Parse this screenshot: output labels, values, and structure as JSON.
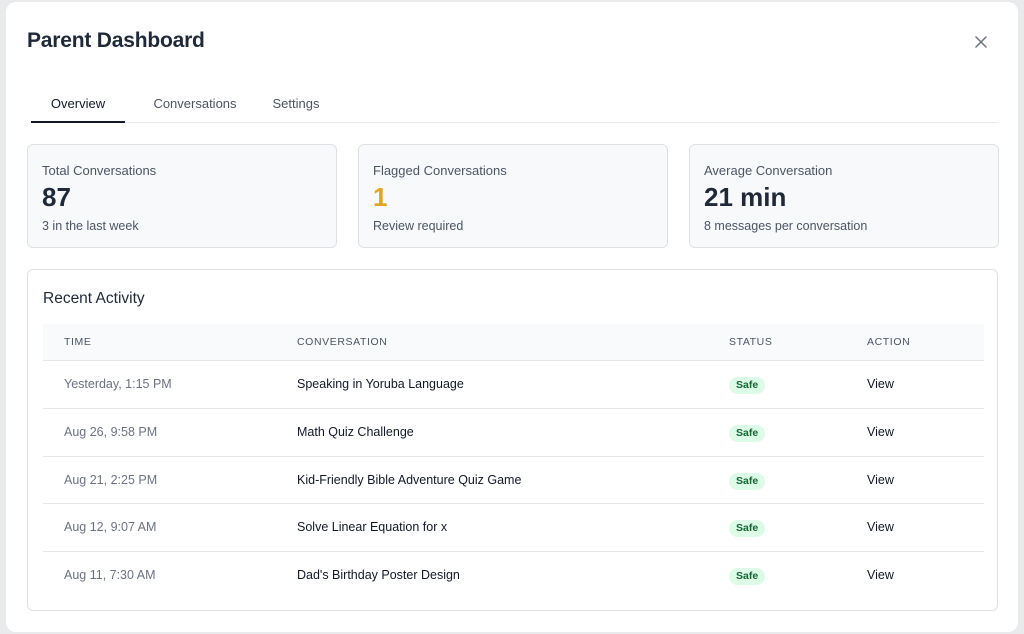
{
  "dialog": {
    "title": "Parent Dashboard",
    "close_icon": "close-icon"
  },
  "tabs": [
    {
      "label": "Overview",
      "active": true
    },
    {
      "label": "Conversations",
      "active": false
    },
    {
      "label": "Settings",
      "active": false
    }
  ],
  "stats": [
    {
      "label": "Total Conversations",
      "value": "87",
      "sub": "3 in the last week",
      "value_color": "#1f2937"
    },
    {
      "label": "Flagged Conversations",
      "value": "1",
      "sub": "Review required",
      "value_color": "#e0a526"
    },
    {
      "label": "Average Conversation",
      "value": "21 min",
      "sub": "8 messages per conversation",
      "value_color": "#1f2937"
    }
  ],
  "activity": {
    "title": "Recent Activity",
    "columns": [
      "TIME",
      "CONVERSATION",
      "STATUS",
      "ACTION"
    ],
    "rows": [
      {
        "time": "Yesterday, 1:15 PM",
        "conversation": "Speaking in Yoruba Language",
        "status": "Safe",
        "action": "View"
      },
      {
        "time": "Aug 26, 9:58 PM",
        "conversation": "Math Quiz Challenge",
        "status": "Safe",
        "action": "View"
      },
      {
        "time": "Aug 21, 2:25 PM",
        "conversation": "Kid-Friendly Bible Adventure Quiz Game",
        "status": "Safe",
        "action": "View"
      },
      {
        "time": "Aug 12, 9:07 AM",
        "conversation": "Solve Linear Equation for x",
        "status": "Safe",
        "action": "View"
      },
      {
        "time": "Aug 11, 7:30 AM",
        "conversation": "Dad's Birthday Poster Design",
        "status": "Safe",
        "action": "View"
      }
    ]
  },
  "colors": {
    "accent_warning": "#e0a526",
    "badge_safe_bg": "#dcfce7",
    "badge_safe_text": "#166534"
  }
}
